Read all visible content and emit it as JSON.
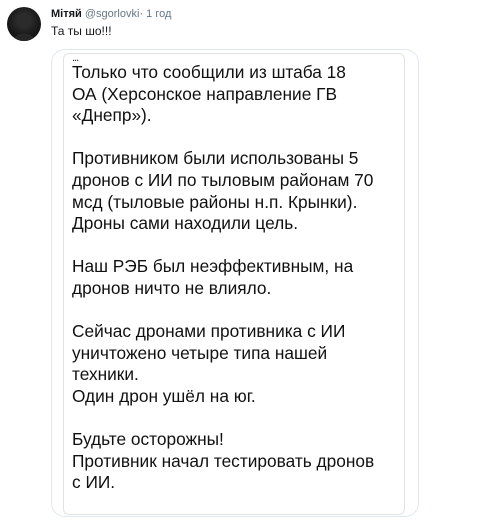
{
  "tweet": {
    "author": "Мітяй",
    "handle": "@sgorlovki",
    "separator": "·",
    "time": "1 год",
    "text": "Та ты шо!!!",
    "avatar_icon": "avatar-dark-icon"
  },
  "attachment": {
    "ellipsis": "...",
    "paragraphs": [
      [
        "Только что сообщили из штаба 18",
        "ОА (Херсонское направление ГВ",
        "«Днепр»)."
      ],
      [
        "Противником были использованы 5",
        "дронов с ИИ по тыловым районам 70",
        "мсд (тыловые районы н.п. Крынки).",
        "Дроны сами находили цель."
      ],
      [
        "Наш РЭБ был неэффективным, на",
        "дронов ничто не влияло."
      ],
      [
        "Сейчас дронами противника с ИИ",
        "уничтожено четыре типа нашей",
        "техники.",
        "Один дрон ушёл на юг."
      ],
      [
        "Будьте осторожны!",
        "Противник начал тестировать дронов",
        "с ИИ."
      ]
    ]
  },
  "colors": {
    "text": "#14171a",
    "muted": "#657786",
    "border": "#e1e8ed"
  }
}
